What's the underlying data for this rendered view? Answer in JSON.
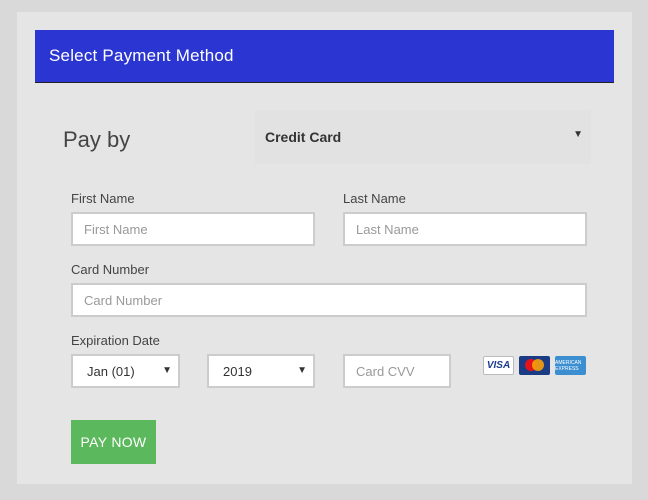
{
  "colors": {
    "header_bg": "#2b35d1",
    "pay_button_bg": "#5cb85c",
    "page_bg": "#d9d9d9",
    "panel_bg": "#e5e5e5"
  },
  "header": {
    "title": "Select Payment Method"
  },
  "payment": {
    "pay_by_label": "Pay by",
    "method_selected": "Credit Card"
  },
  "form": {
    "first_name": {
      "label": "First Name",
      "placeholder": "First Name"
    },
    "last_name": {
      "label": "Last Name",
      "placeholder": "Last Name"
    },
    "card_number": {
      "label": "Card Number",
      "placeholder": "Card Number"
    },
    "expiration": {
      "label": "Expiration Date",
      "month_selected": "Jan (01)",
      "year_selected": "2019"
    },
    "cvv": {
      "placeholder": "Card CVV"
    },
    "card_logos": [
      "visa",
      "mastercard",
      "amex"
    ],
    "card_logo_texts": {
      "visa": "VISA",
      "amex": "AMERICAN EXPRESS"
    }
  },
  "submit": {
    "label": "PAY NOW"
  }
}
